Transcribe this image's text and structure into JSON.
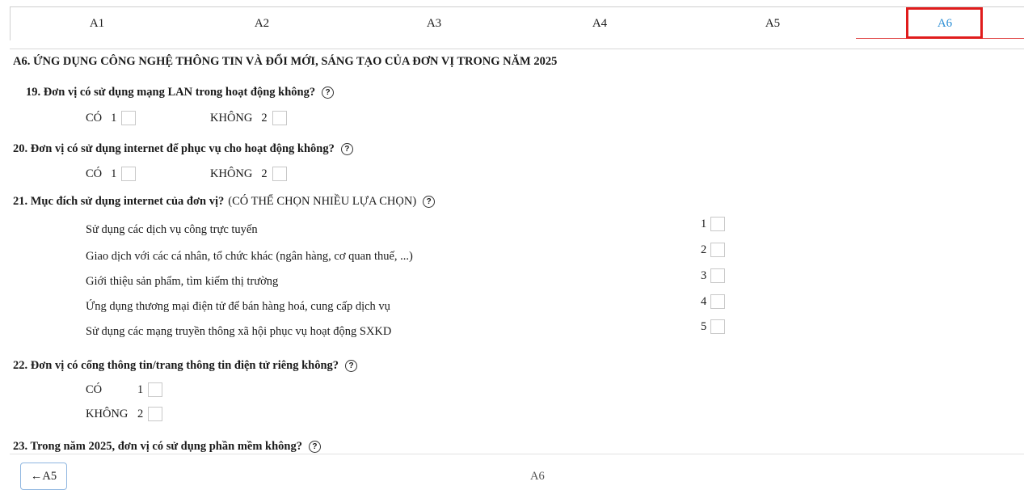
{
  "tabs": [
    {
      "label": "A1"
    },
    {
      "label": "A2"
    },
    {
      "label": "A3"
    },
    {
      "label": "A4"
    },
    {
      "label": "A5"
    },
    {
      "label": "A6"
    }
  ],
  "active_tab": "A6",
  "accent_color": "#2d8fd5",
  "highlight_color": "#e01c1c",
  "section_title": "A6. ỨNG DỤNG CÔNG NGHỆ THÔNG TIN VÀ ĐỔI MỚI, SÁNG TẠO CỦA ĐƠN VỊ TRONG NĂM 2025",
  "help_glyph": "?",
  "q19": {
    "text": "19. Đơn vị có sử dụng mạng LAN trong hoạt động không?",
    "yes_label": "CÓ",
    "yes_code": "1",
    "no_label": "KHÔNG",
    "no_code": "2"
  },
  "q20": {
    "text": "20. Đơn vị có sử dụng internet để phục vụ cho hoạt động không?",
    "yes_label": "CÓ",
    "yes_code": "1",
    "no_label": "KHÔNG",
    "no_code": "2"
  },
  "q21": {
    "text": "21. Mục đích sử dụng internet của đơn vị?",
    "note": "(CÓ THỂ CHỌN NHIỀU LỰA CHỌN)",
    "options": [
      {
        "label": "Sử dụng các dịch vụ công trực tuyến",
        "code": "1"
      },
      {
        "label": "Giao dịch với các cá nhân, tổ chức khác (ngân hàng, cơ quan thuế, ...)",
        "code": "2"
      },
      {
        "label": "Giới thiệu sản phẩm, tìm kiếm thị trường",
        "code": "3"
      },
      {
        "label": "Ứng dụng thương mại điện tử để bán hàng hoá, cung cấp dịch vụ",
        "code": "4"
      },
      {
        "label": "Sử dụng các mạng truyền thông xã hội phục vụ hoạt động SXKD",
        "code": "5"
      }
    ]
  },
  "q22": {
    "text": "22. Đơn vị có cổng thông tin/trang thông tin điện tử riêng không?",
    "yes_label": "CÓ",
    "yes_code": "1",
    "no_label": "KHÔNG",
    "no_code": "2"
  },
  "q23": {
    "text": "23. Trong năm 2025, đơn vị có sử dụng phần mềm không?"
  },
  "footer": {
    "back_label": "←A5",
    "current_label": "A6"
  }
}
